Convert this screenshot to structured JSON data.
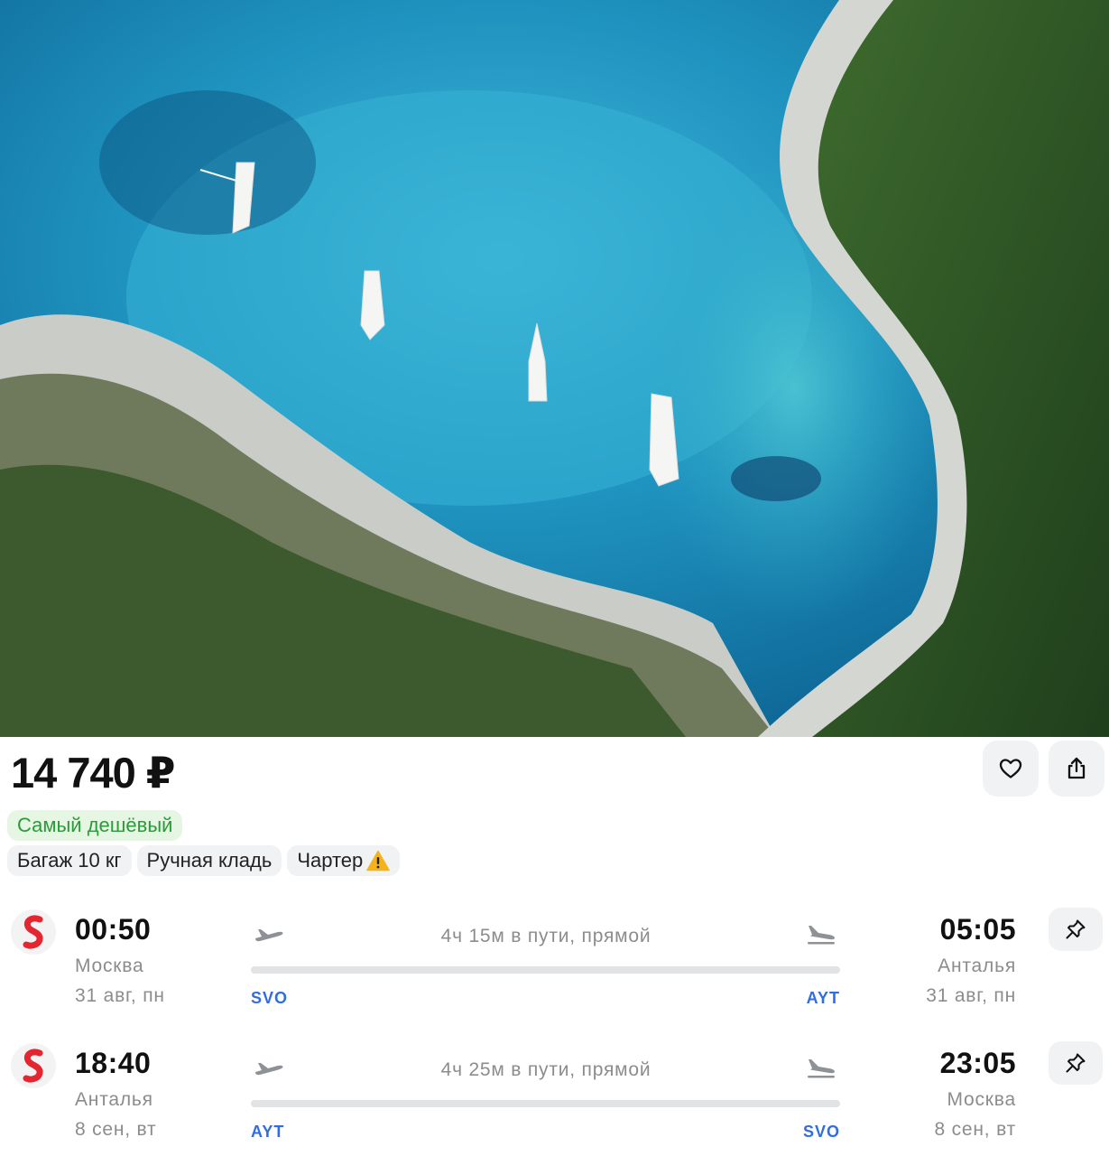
{
  "offer": {
    "price": "14 740 ₽",
    "cheapest_badge": "Самый дешёвый",
    "tags": [
      "Багаж 10 кг",
      "Ручная кладь",
      "Чартер"
    ],
    "charter_warning_icon": "warning-icon"
  },
  "actions": {
    "favorite_icon": "heart-icon",
    "share_icon": "share-icon"
  },
  "legs": [
    {
      "airline_icon": "s7-airline-logo",
      "dep_time": "00:50",
      "dep_city": "Москва",
      "dep_date": "31 авг, пн",
      "dep_code": "SVO",
      "duration": "4ч 15м в пути, прямой",
      "arr_time": "05:05",
      "arr_city": "Анталья",
      "arr_date": "31 авг, пн",
      "arr_code": "AYT"
    },
    {
      "airline_icon": "s7-airline-logo",
      "dep_time": "18:40",
      "dep_city": "Анталья",
      "dep_date": "8 сен, вт",
      "dep_code": "AYT",
      "duration": "4ч 25м в пути, прямой",
      "arr_time": "23:05",
      "arr_city": "Москва",
      "arr_date": "8 сен, вт",
      "arr_code": "SVO"
    }
  ],
  "colors": {
    "accent_blue": "#2f6de1",
    "badge_green_text": "#2c9a3a",
    "badge_green_bg": "#e5f6e3",
    "airline_red": "#e3262f",
    "muted_text": "#8c8c8c"
  }
}
